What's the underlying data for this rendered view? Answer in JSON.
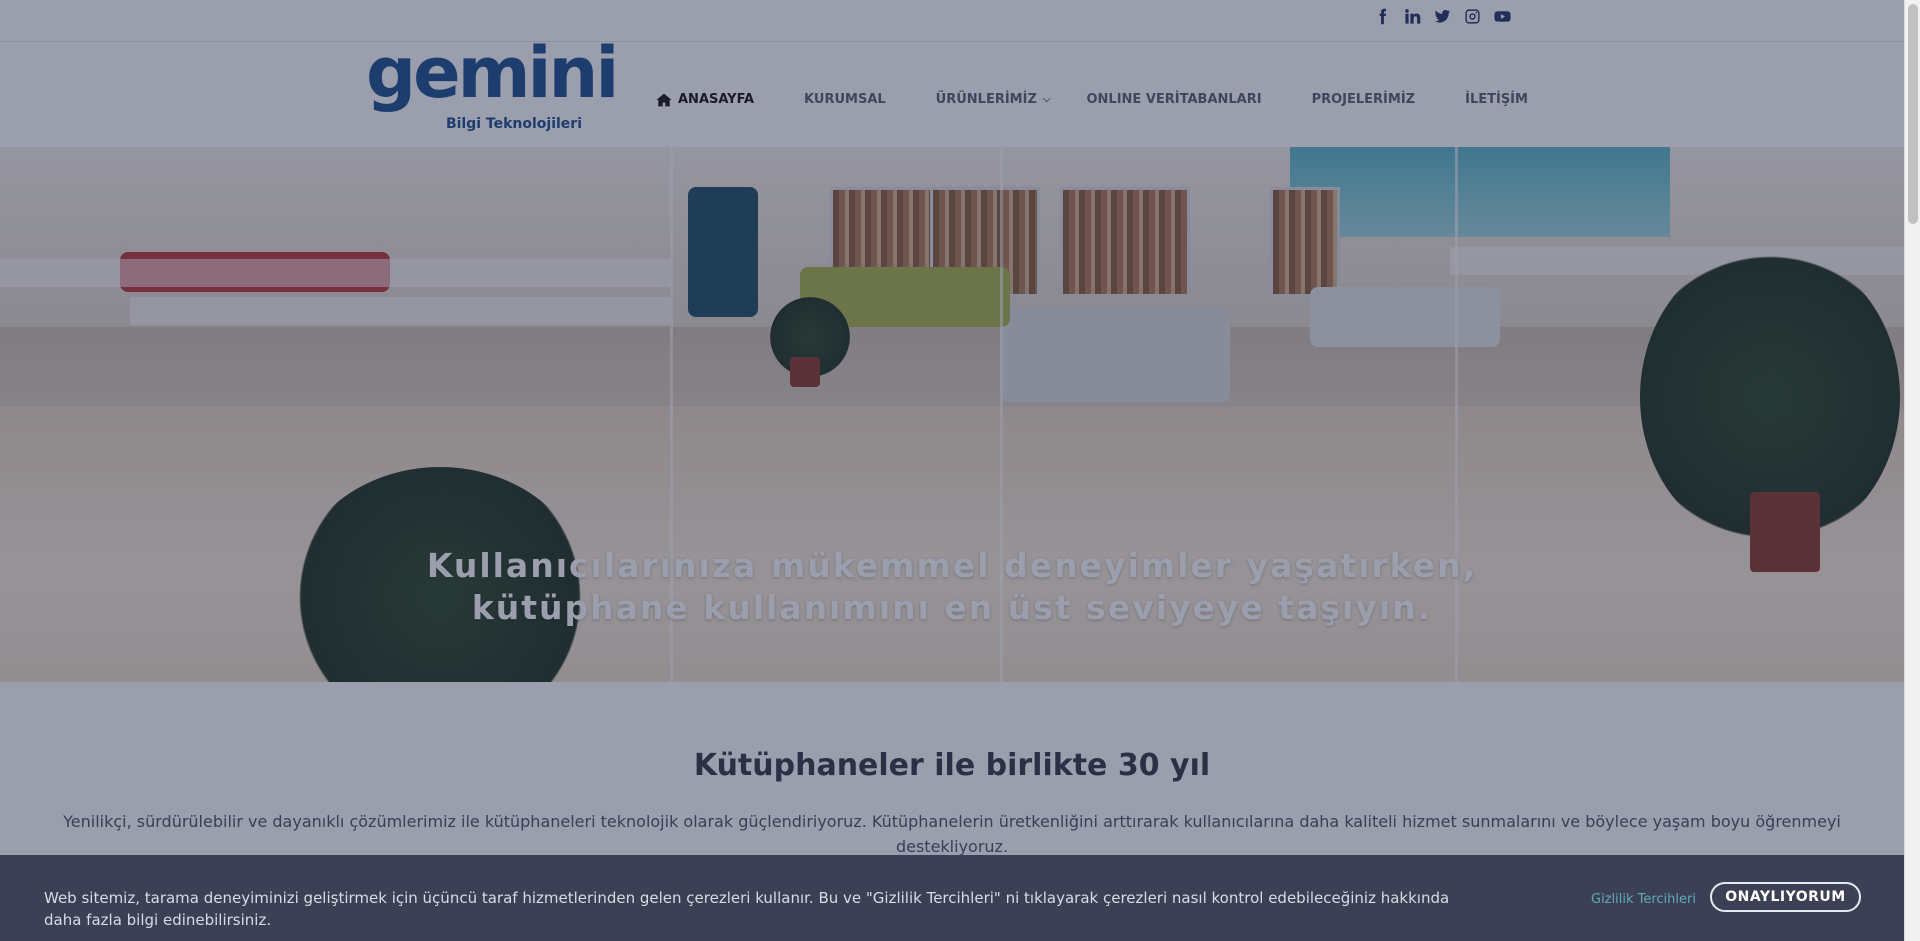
{
  "social": [
    "facebook-icon",
    "linkedin-icon",
    "twitter-icon",
    "instagram-icon",
    "youtube-icon"
  ],
  "logo": {
    "word": "gemini",
    "sub": "Bilgi Teknolojileri"
  },
  "nav": {
    "home": "ANASAYFA",
    "corporate": "KURUMSAL",
    "products": "ÜRÜNLERİMİZ",
    "databases": "ONLINE VERİTABANLARI",
    "projects": "PROJELERİMİZ",
    "contact": "İLETİŞİM"
  },
  "hero": {
    "line1": "Kullanıcılarınıza mükemmel deneyimler yaşatırken,",
    "line2": "kütüphane kullanımını en üst seviyeye taşıyın."
  },
  "section": {
    "title": "Kütüphaneler ile birlikte 30 yıl",
    "text": "Yenilikçi, sürdürülebilir ve dayanıklı çözümlerimiz ile kütüphaneleri teknolojik olarak güçlendiriyoruz. Kütüphanelerin üretkenliğini arttırarak kullanıcılarına daha kaliteli hizmet sunmalarını ve böylece yaşam boyu öğrenmeyi destekliyoruz."
  },
  "cookie": {
    "text": "Web sitemiz, tarama deneyiminizi geliştirmek için üçüncü taraf hizmetlerinden gelen çerezleri kullanır. Bu ve \"Gizlilik Tercihleri\" ni tıklayarak çerezleri nasıl kontrol edebileceğiniz hakkında daha fazla bilgi edinebilirsiniz.",
    "preferences": "Gizlilik Tercihleri",
    "accept": "ONAYLIYORUM"
  },
  "colors": {
    "brand": "#1b4f8f",
    "cookie_bg": "#3c4055",
    "link": "#5fa9b8"
  }
}
